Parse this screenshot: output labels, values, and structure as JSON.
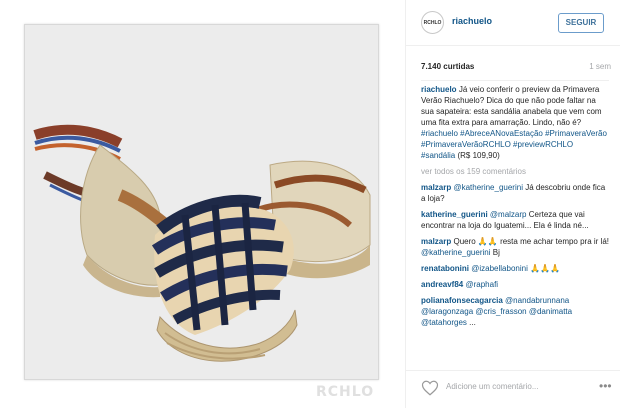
{
  "header": {
    "avatar_text": "RCHLO",
    "username": "riachuelo",
    "follow_label": "SEGUIR"
  },
  "meta": {
    "likes": "7.140 curtidas",
    "time": "1 sem"
  },
  "caption": {
    "user": "riachuelo",
    "text": "Já veio conferir o preview da Primavera Verão Riachuelo? Dica do que não pode faltar na sua sapateira: esta sandália anabela que vem com uma fita extra para amarração. Lindo, não é?",
    "tags": [
      "#riachuelo",
      "#AbreceANovaEstação",
      "#PrimaveraVerão",
      "#PrimaveraVerãoRCHLO",
      "#previewRCHLO",
      "#sandália"
    ],
    "price": "(R$ 109,90)"
  },
  "view_all": "ver todos os 159 comentários",
  "comments": [
    {
      "user": "malzarp",
      "mention": "@katherine_guerini",
      "text": "Já descobriu onde fica a loja?"
    },
    {
      "user": "katherine_guerini",
      "mention": "@malzarp",
      "text": "Certeza que vai encontrar na loja do Iguatemi... Ela é linda né..."
    },
    {
      "user": "malzarp",
      "mention": "",
      "text": "Quero 🙏🙏 resta me achar tempo pra ir lá!",
      "mention2": "@katherine_guerini",
      "tail": "Bj"
    },
    {
      "user": "renatabonini",
      "mention": "@izabellabonini",
      "text": "🙏🙏🙏"
    },
    {
      "user": "andreavf84",
      "mention": "@raphafi",
      "text": ""
    },
    {
      "user": "polianafonsecagarcia",
      "mention": "@nandabrunnana @laragonzaga @cris_frasson @danimatta @tatahorges",
      "text": "..."
    }
  ],
  "footer": {
    "add_comment_placeholder": "Adicione um comentário...",
    "more_label": "•••"
  },
  "watermark": "RCHLO",
  "colors": {
    "link_blue": "#125688",
    "follow_blue": "#3f729b",
    "muted_gray": "#a5a7aa",
    "photo_bg": "#ececec"
  }
}
